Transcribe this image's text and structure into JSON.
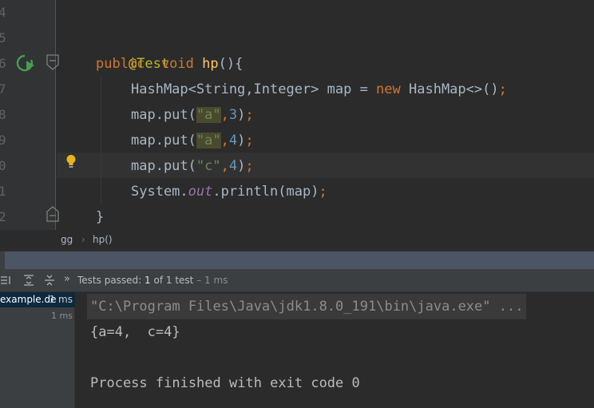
{
  "editor": {
    "line_numbers": [
      "4",
      "5",
      "6",
      "7",
      "8",
      "9",
      "0",
      "1",
      "2"
    ],
    "lines": {
      "annotation": "@Test",
      "decl_kw1": "public",
      "decl_kw2": "void",
      "decl_fn": "hp",
      "decl_tail": "(){",
      "l7_a": "HashMap<String,Integer> map = ",
      "l7_new": "new",
      "l7_b": " HashMap<>()",
      "semi": ";",
      "put_prefix": "map.put(",
      "put1_key": "\"a\"",
      "put1_val": "3",
      "put2_key": "\"a\"",
      "put2_val": "4",
      "put3_key": "\"c\"",
      "put3_val": "4",
      "comma": ",",
      "close_paren": ")",
      "print_a": "System.",
      "print_field": "out",
      "print_b": ".println(map)",
      "closing_brace": "}"
    }
  },
  "breadcrumb": {
    "class_name": "gg",
    "separator": "›",
    "method_name": "hp()"
  },
  "test_toolbar": {
    "expand_symbol": "»",
    "status_prefix": "Tests passed: ",
    "passed_count": "1",
    "status_middle": " of 1 test",
    "status_time": " – 1 ms"
  },
  "test_tree": {
    "rows": [
      {
        "label": "example.de",
        "time": "1 ms"
      },
      {
        "label": "",
        "time": "1 ms"
      }
    ]
  },
  "console": {
    "command": "\"C:\\Program Files\\Java\\jdk1.8.0_191\\bin\\java.exe\" ...",
    "output": "{a=4,  c=4}",
    "exit_message": "Process finished with exit code 0"
  },
  "colors": {
    "editor_bg": "#2b2b2b",
    "keyword": "#cc7832",
    "string": "#6a8759",
    "number": "#6897bb",
    "annotation": "#bbb529",
    "function": "#ffc66d",
    "run_icon": "#499c54"
  }
}
